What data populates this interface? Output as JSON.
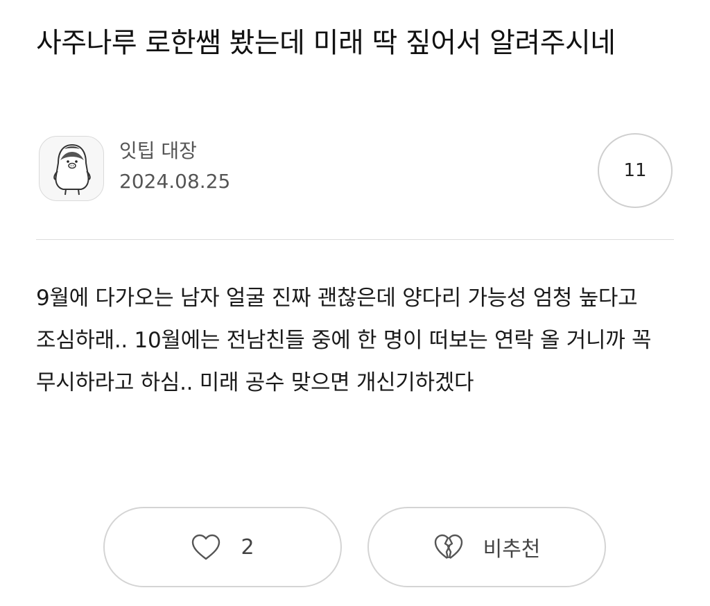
{
  "post": {
    "title": "사주나루 로한쌤 봤는데 미래 딱 짚어서 알려주시네",
    "author": "잇팁 대장",
    "date": "2024.08.25",
    "comment_count": "11",
    "body": "9월에 다가오는 남자 얼굴 진짜 괜찮은데 양다리 가능성 엄청 높다고 조심하래.. 10월에는 전남친들 중에 한 명이 떠보는 연락 올 거니까 꼭 무시하라고 하심.. 미래 공수 맞으면 개신기하겠다"
  },
  "actions": {
    "like_count": "2",
    "like_icon": "heart-outline-icon",
    "dislike_label": "비추천",
    "dislike_icon": "broken-heart-icon"
  },
  "colors": {
    "border": "#d4d4d4",
    "text_primary": "#111111",
    "text_secondary": "#555555"
  }
}
